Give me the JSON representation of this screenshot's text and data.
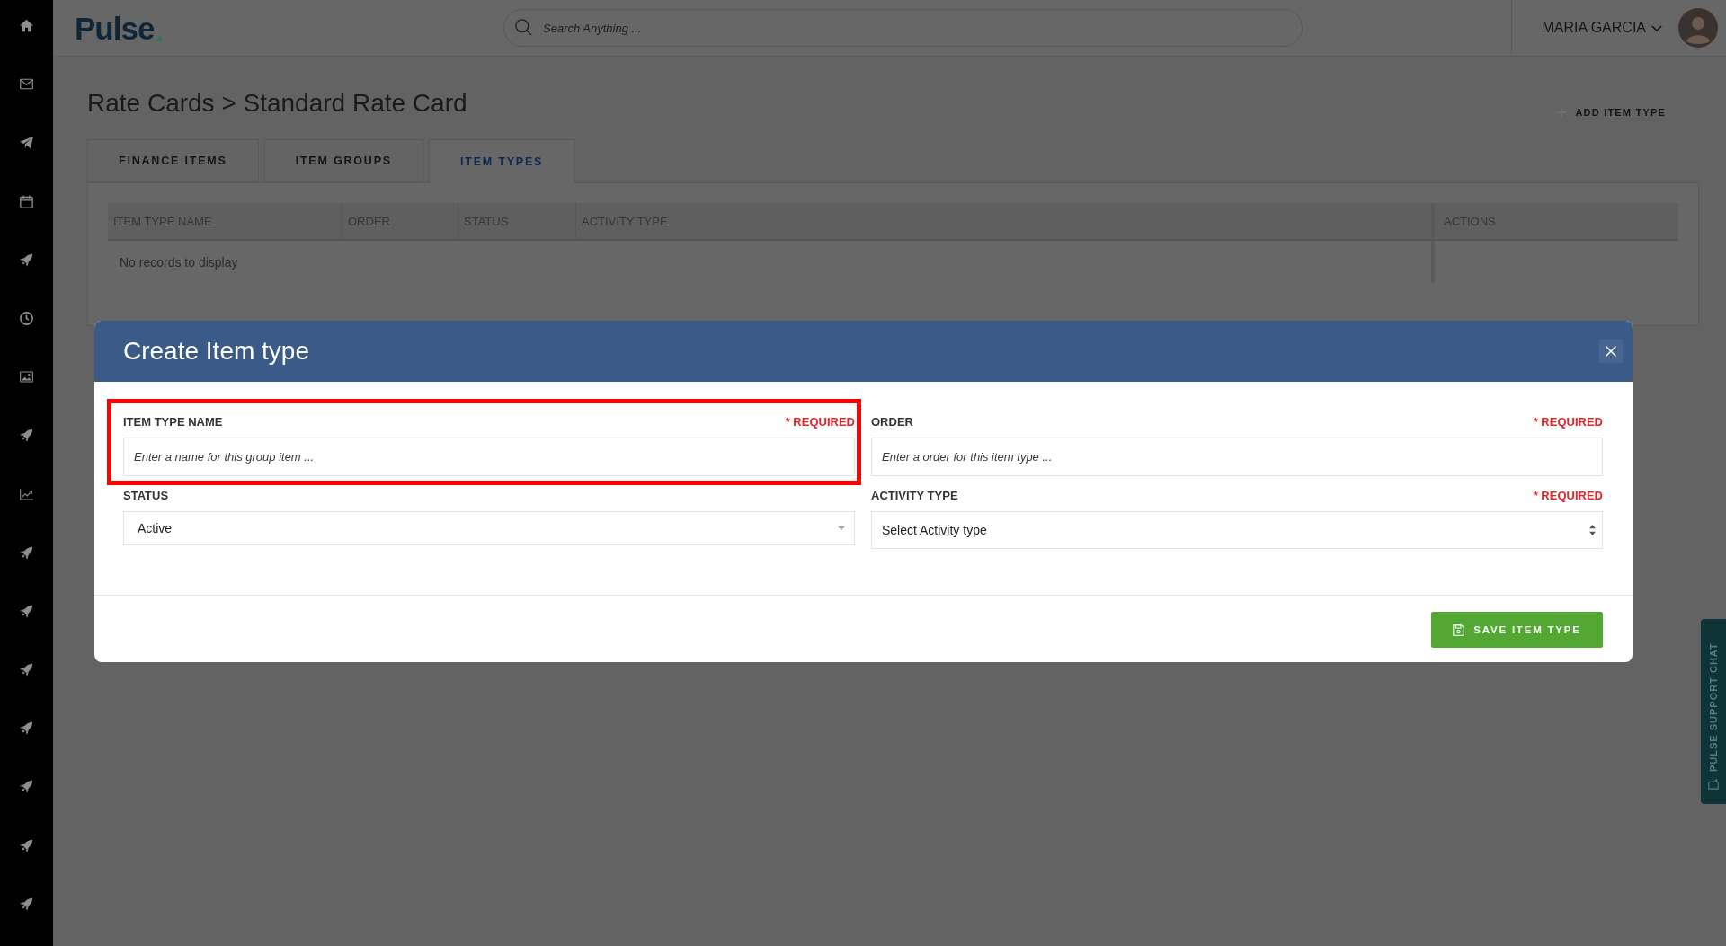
{
  "header": {
    "logo": "Pulse",
    "search": {
      "placeholder": "Search Anything ..."
    },
    "user": {
      "name": "MARIA GARCIA"
    }
  },
  "page": {
    "breadcrumb": "Rate Cards > Standard Rate Card",
    "action": "ADD ITEM TYPE",
    "tabs": [
      {
        "label": "FINANCE ITEMS",
        "selected": false
      },
      {
        "label": "ITEM GROUPS",
        "selected": false
      },
      {
        "label": "ITEM TYPES",
        "selected": true
      }
    ],
    "table": {
      "columns": [
        "ITEM TYPE NAME",
        "ORDER",
        "STATUS",
        "ACTIVITY TYPE",
        "ACTIONS"
      ],
      "empty_message": "No records to display"
    }
  },
  "modal": {
    "title": "Create Item type",
    "fields": [
      {
        "label": "ITEM TYPE NAME",
        "required": "* REQUIRED",
        "kind": "text",
        "placeholder": "Enter a name for this group item ...",
        "highlighted": true
      },
      {
        "label": "ORDER",
        "required": "* REQUIRED",
        "kind": "text",
        "placeholder": "Enter a order for this item type ...",
        "highlighted": false
      },
      {
        "label": "STATUS",
        "kind": "dropdown",
        "value": "Active",
        "highlighted": false
      },
      {
        "label": "ACTIVITY TYPE",
        "required": "* REQUIRED",
        "kind": "select",
        "value": "Select Activity type",
        "highlighted": false
      }
    ],
    "save_button": "SAVE ITEM TYPE"
  },
  "support_chat": {
    "label": "PULSE SUPPORT CHAT"
  }
}
